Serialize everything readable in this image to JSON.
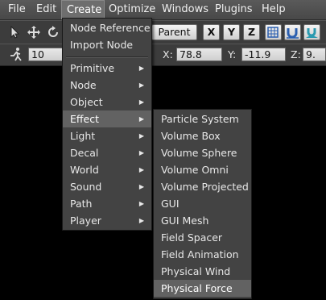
{
  "menubar": {
    "items": [
      "File",
      "Edit",
      "Create",
      "Optimize",
      "Windows",
      "Plugins",
      "Help"
    ],
    "active": "Create"
  },
  "toolbar": {
    "parent_label": "Parent",
    "axis_x": "X",
    "axis_y": "Y",
    "axis_z": "Z",
    "step_value": "10",
    "x_label": "X:",
    "x_value": "78.8",
    "y_label": "Y:",
    "y_value": "-11.9",
    "z_label": "Z:",
    "z_value": "9."
  },
  "create_menu": {
    "top_items": [
      "Node Reference",
      "Import Node"
    ],
    "sub_items": [
      "Primitive",
      "Node",
      "Object",
      "Effect",
      "Light",
      "Decal",
      "World",
      "Sound",
      "Path",
      "Player"
    ],
    "highlighted": "Effect"
  },
  "effect_menu": {
    "items": [
      "Particle System",
      "Volume Box",
      "Volume Sphere",
      "Volume Omni",
      "Volume Projected",
      "GUI",
      "GUI Mesh",
      "Field Spacer",
      "Field Animation",
      "Physical Wind",
      "Physical Force"
    ],
    "highlighted": "Physical Force"
  },
  "colors": {
    "menu_bg": "#434343",
    "highlight_bg": "#626262",
    "toolbar_bg": "#3c3c3c",
    "viewport_bg": "#000000"
  }
}
